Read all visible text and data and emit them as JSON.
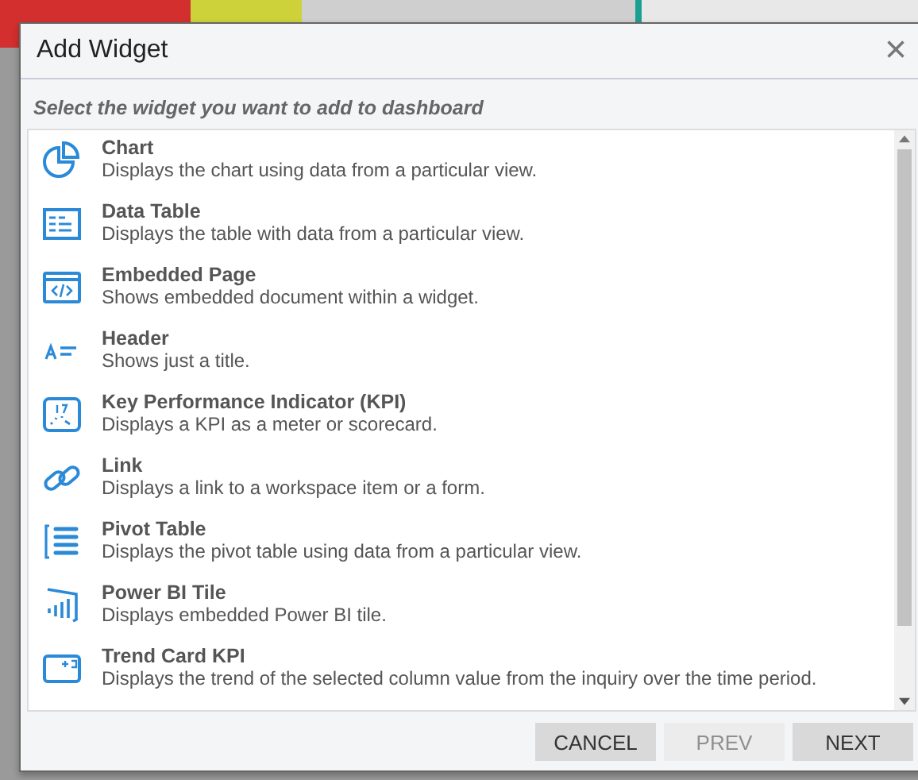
{
  "dialog": {
    "title": "Add Widget",
    "close": "×",
    "instruction": "Select the widget you want to add to dashboard"
  },
  "widgets": [
    {
      "kind": "chart",
      "name": "Chart",
      "description": "Displays the chart using data from a particular view."
    },
    {
      "kind": "table",
      "name": "Data Table",
      "description": "Displays the table with data from a particular view."
    },
    {
      "kind": "embed",
      "name": "Embedded Page",
      "description": "Shows embedded document within a widget."
    },
    {
      "kind": "header",
      "name": "Header",
      "description": "Shows just a title."
    },
    {
      "kind": "kpi",
      "name": "Key Performance Indicator (KPI)",
      "description": "Displays a KPI as a meter or scorecard."
    },
    {
      "kind": "link",
      "name": "Link",
      "description": "Displays a link to a workspace item or a form."
    },
    {
      "kind": "pivot",
      "name": "Pivot Table",
      "description": "Displays the pivot table using data from a particular view."
    },
    {
      "kind": "powerbi",
      "name": "Power BI Tile",
      "description": "Displays embedded Power BI tile."
    },
    {
      "kind": "trend",
      "name": "Trend Card KPI",
      "description": "Displays the trend of the selected column value from the inquiry over the time period."
    }
  ],
  "buttons": [
    {
      "label": "CANCEL",
      "disabled": false
    },
    {
      "label": "PREV",
      "disabled": true
    },
    {
      "label": "NEXT",
      "disabled": false
    }
  ]
}
